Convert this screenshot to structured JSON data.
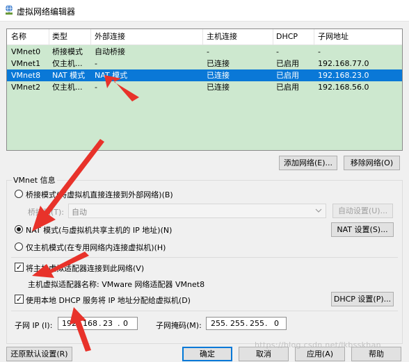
{
  "window": {
    "title": "虚拟网络编辑器",
    "icon": "network-editor-icon"
  },
  "table": {
    "columns": [
      "名称",
      "类型",
      "外部连接",
      "主机连接",
      "DHCP",
      "子网地址"
    ],
    "rows": [
      {
        "name": "VMnet0",
        "type": "桥接模式",
        "external": "自动桥接",
        "host": "-",
        "dhcp": "-",
        "subnet": "-",
        "selected": false
      },
      {
        "name": "VMnet1",
        "type": "仅主机...",
        "external": "-",
        "host": "已连接",
        "dhcp": "已启用",
        "subnet": "192.168.77.0",
        "selected": false
      },
      {
        "name": "VMnet8",
        "type": "NAT 模式",
        "external": "NAT 模式",
        "host": "已连接",
        "dhcp": "已启用",
        "subnet": "192.168.23.0",
        "selected": true
      },
      {
        "name": "VMnet2",
        "type": "仅主机...",
        "external": "-",
        "host": "已连接",
        "dhcp": "已启用",
        "subnet": "192.168.56.0",
        "selected": false
      }
    ]
  },
  "table_buttons": {
    "add": "添加网络(E)...",
    "remove": "移除网络(O)"
  },
  "vmnet_info": {
    "legend": "VMnet 信息",
    "bridge_mode": "桥接模式(将虚拟机直接连接到外部网络)(B)",
    "bridge_to_label": "桥接到(T):",
    "bridge_to_value": "自动",
    "auto_settings": "自动设置(U)...",
    "nat_mode": "NAT 模式(与虚拟机共享主机的 IP 地址)(N)",
    "nat_settings": "NAT 设置(S)...",
    "host_only": "仅主机模式(在专用网络内连接虚拟机)(H)",
    "connect_adapter": "将主机虚拟适配器连接到此网络(V)",
    "adapter_name": "主机虚拟适配器名称: VMware 网络适配器 VMnet8",
    "use_dhcp": "使用本地 DHCP 服务将 IP 地址分配给虚拟机(D)",
    "dhcp_settings": "DHCP 设置(P)...",
    "selected_mode": "nat",
    "connect_adapter_checked": true,
    "use_dhcp_checked": true
  },
  "subnet": {
    "ip_label": "子网 IP (I):",
    "ip": [
      "192",
      "168",
      "23",
      "0"
    ],
    "mask_label": "子网掩码(M):",
    "mask": [
      "255",
      "255",
      "255",
      "0"
    ]
  },
  "footer": {
    "restore": "还原默认设置(R)",
    "ok": "确定",
    "cancel": "取消",
    "apply": "应用(A)",
    "help": "帮助"
  },
  "watermark": "https://blog.csdn.net/lkbsskhan",
  "colors": {
    "table_bg": "#cde8cf",
    "selection": "#0a78d7",
    "arrow": "#e8322a"
  }
}
